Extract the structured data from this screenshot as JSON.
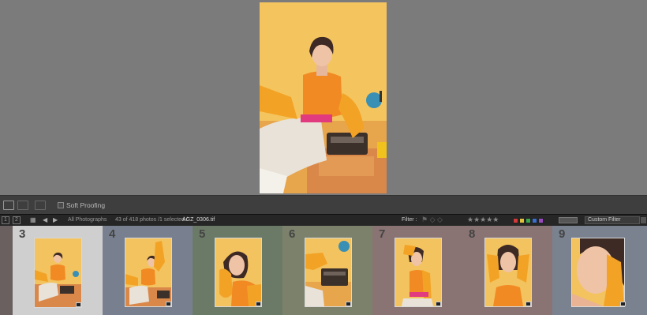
{
  "toolbar": {
    "soft_proofing_label": "Soft Proofing"
  },
  "filmstrip_bar": {
    "page1": "1",
    "page2": "2",
    "source": "All Photographs",
    "status": "43 of 418 photos /1 selected /",
    "filename": "AGZ_0306.tif",
    "filter_label": "Filter :",
    "stars": "★★★★★",
    "custom_filter": "Custom Filter"
  },
  "filmstrip": {
    "cells": [
      {
        "index": "3",
        "label_color": "#c9c9c9",
        "selected": true
      },
      {
        "index": "4",
        "label_color": "#7a8290"
      },
      {
        "index": "5",
        "label_color": "#6c7a68"
      },
      {
        "index": "6",
        "label_color": "#7d826c"
      },
      {
        "index": "7",
        "label_color": "#8c7474"
      },
      {
        "index": "8",
        "label_color": "#8c7474"
      },
      {
        "index": "9",
        "label_color": "#7a8290"
      }
    ]
  },
  "color_labels": [
    "#d23a3a",
    "#e0c23a",
    "#3aa84a",
    "#3a6fd0",
    "#9a4ac0"
  ],
  "icons": [
    "loupe-view-icon",
    "compare-view-icon",
    "survey-view-icon",
    "grid-view-icon",
    "back-arrow-icon",
    "forward-arrow-icon",
    "flag-icon",
    "lock-icon"
  ]
}
